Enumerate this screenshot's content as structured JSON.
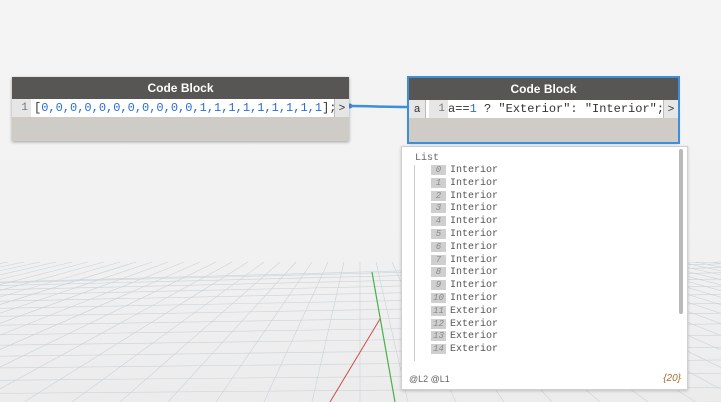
{
  "nodes": [
    {
      "title": "Code Block",
      "line_number": "1",
      "code_open": "[",
      "code_values": "0,0,0,0,0,0,0,0,0,0,0,1,1,1,1,1,1,1,1,1",
      "code_close": "];",
      "output_port": ">"
    },
    {
      "title": "Code Block",
      "input_port": "a",
      "line_number": "1",
      "code_a": "a==",
      "code_one": "1",
      "code_rest": " ? \"Exterior\": \"Interior\";",
      "output_port": ">"
    }
  ],
  "preview": {
    "title": "List",
    "items": [
      {
        "index": "0",
        "value": "Interior"
      },
      {
        "index": "1",
        "value": "Interior"
      },
      {
        "index": "2",
        "value": "Interior"
      },
      {
        "index": "3",
        "value": "Interior"
      },
      {
        "index": "4",
        "value": "Interior"
      },
      {
        "index": "5",
        "value": "Interior"
      },
      {
        "index": "6",
        "value": "Interior"
      },
      {
        "index": "7",
        "value": "Interior"
      },
      {
        "index": "8",
        "value": "Interior"
      },
      {
        "index": "9",
        "value": "Interior"
      },
      {
        "index": "10",
        "value": "Interior"
      },
      {
        "index": "11",
        "value": "Exterior"
      },
      {
        "index": "12",
        "value": "Exterior"
      },
      {
        "index": "13",
        "value": "Exterior"
      },
      {
        "index": "14",
        "value": "Exterior"
      }
    ],
    "levels": "@L2 @L1",
    "count": "{20}"
  },
  "colors": {
    "node_header": "#585654",
    "node_body": "#cfcbc6",
    "selection": "#3e8fdb",
    "wire": "#3e8fdb",
    "number_literal": "#2a6fd6"
  }
}
